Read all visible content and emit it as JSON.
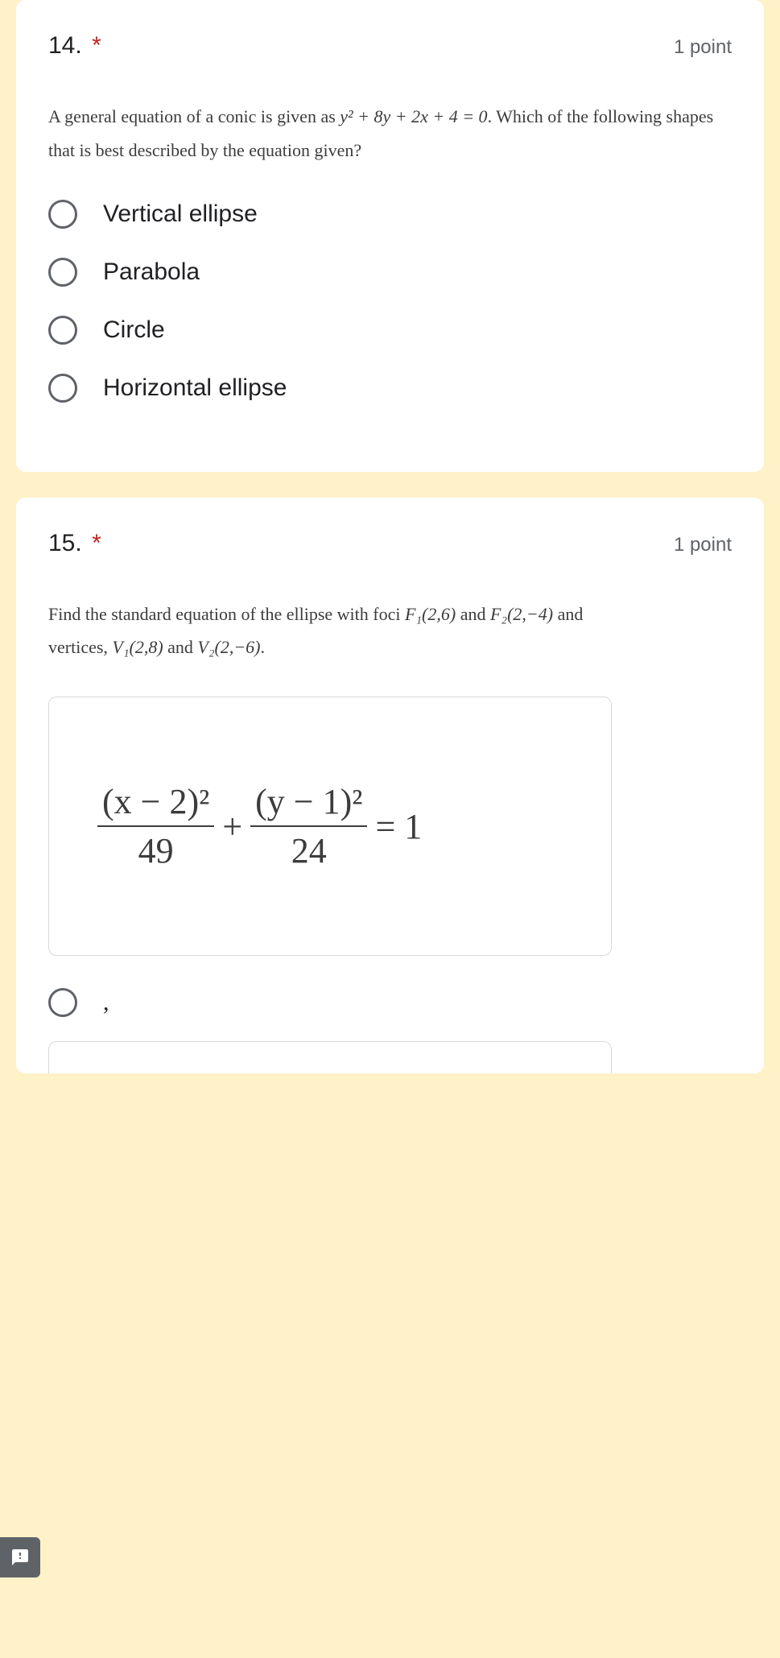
{
  "q14": {
    "number": "14.",
    "required_mark": "*",
    "points": "1 point",
    "prompt_pre": "A general equation of a conic is given as  ",
    "prompt_eq": "y² + 8y + 2x + 4 = 0",
    "prompt_post": ". Which of the following shapes that is best described by the equation given?",
    "options": [
      "Vertical ellipse",
      "Parabola",
      "Circle",
      "Horizontal ellipse"
    ]
  },
  "q15": {
    "number": "15.",
    "required_mark": "*",
    "points": "1 point",
    "prompt_line1_a": "Find the standard equation of the ellipse with foci  ",
    "prompt_f1": "F₁(2,6)",
    "prompt_and1": " and ",
    "prompt_f2": "F₂(2,−4)",
    "prompt_and2": " and",
    "prompt_line2_a": "vertices, ",
    "prompt_v1": "V₁(2,8)",
    "prompt_and3": " and ",
    "prompt_v2": "V₂(2,−6)",
    "prompt_period": ".",
    "equation": {
      "num1": "(x − 2)²",
      "den1": "49",
      "plus": "+",
      "num2": "(y − 1)²",
      "den2": "24",
      "eq": "= 1"
    },
    "option_mark": ","
  }
}
